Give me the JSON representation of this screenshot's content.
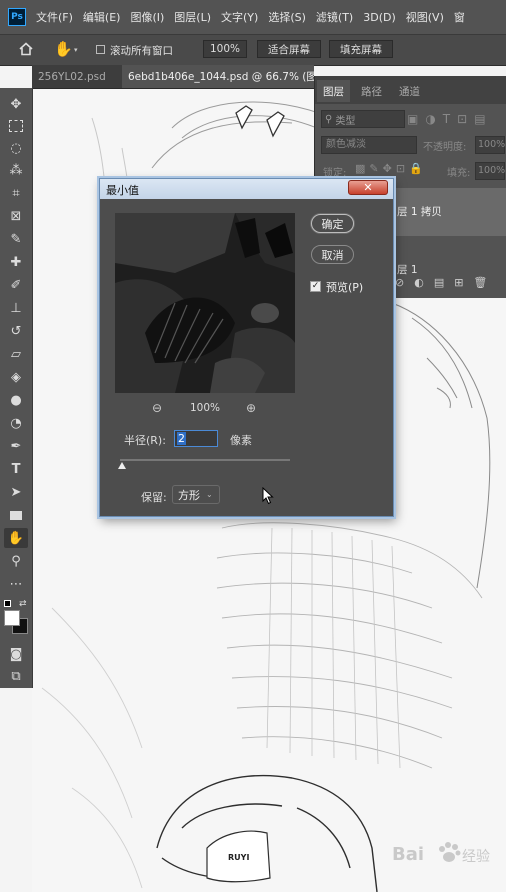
{
  "menubar": {
    "logo": "Ps",
    "items": [
      "文件(F)",
      "编辑(E)",
      "图像(I)",
      "图层(L)",
      "文字(Y)",
      "选择(S)",
      "滤镜(T)",
      "3D(D)",
      "视图(V)",
      "窗"
    ]
  },
  "options": {
    "scroll_all_label": "滚动所有窗口",
    "zoom_value": "100%",
    "fit_screen_label": "适合屏幕",
    "fill_screen_label": "填充屏幕"
  },
  "tabs": [
    {
      "label": "256YL02.psd",
      "active": false
    },
    {
      "label": "6ebd1b406e_1044.psd @ 66.7% (图层",
      "active": true
    }
  ],
  "layers_panel": {
    "tabs": [
      "图层",
      "路径",
      "通道"
    ],
    "kind_filter": "类型",
    "blend_mode": "颜色减淡",
    "opacity_label": "不透明度:",
    "opacity_value": "100%",
    "lock_label": "锁定:",
    "fill_label": "填充:",
    "fill_value": "100%",
    "layer_copy_name": "层 1 拷贝",
    "layer_name": "层 1"
  },
  "dialog": {
    "title": "最小值",
    "ok_label": "确定",
    "cancel_label": "取消",
    "preview_label": "预览(P)",
    "preview_checked": true,
    "zoom_value": "100%",
    "radius_label": "半径(R):",
    "radius_value": "2",
    "radius_unit": "像素",
    "preserve_label": "保留:",
    "preserve_value": "方形"
  },
  "watermark": {
    "brand_text": "Bai",
    "site_text": "经验"
  },
  "colors": {
    "ui_dark": "#535353",
    "panel_bg": "#4d4d4d",
    "accent_blue": "#31a8ff",
    "dialog_border": "#6a8cb2"
  }
}
